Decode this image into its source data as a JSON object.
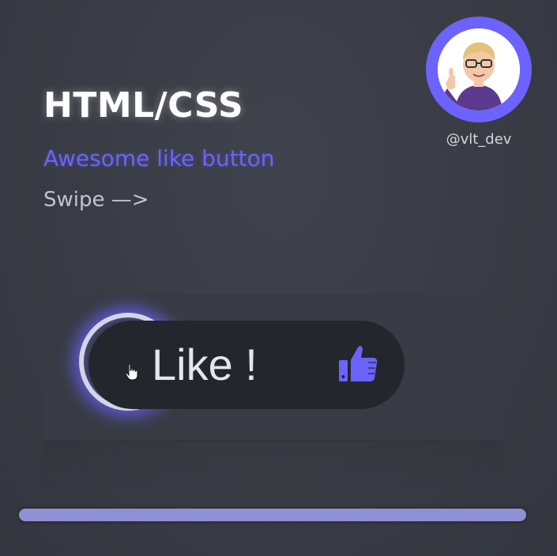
{
  "header": {
    "title": "HTML/CSS",
    "subtitle": "Awesome like button",
    "swipe": "Swipe —>"
  },
  "author": {
    "handle": "@vlt_dev",
    "avatar_icon": "memoji-thumbs-up-avatar"
  },
  "demo": {
    "button_label": "Like !",
    "button_icon": "thumbs-up-icon",
    "cursor_icon": "hand-pointer-icon"
  },
  "progress": {
    "value": 1.0
  },
  "colors": {
    "accent": "#6c63ff",
    "background": "#383b43",
    "button": "#24262d",
    "progress": "#8f91d4"
  }
}
